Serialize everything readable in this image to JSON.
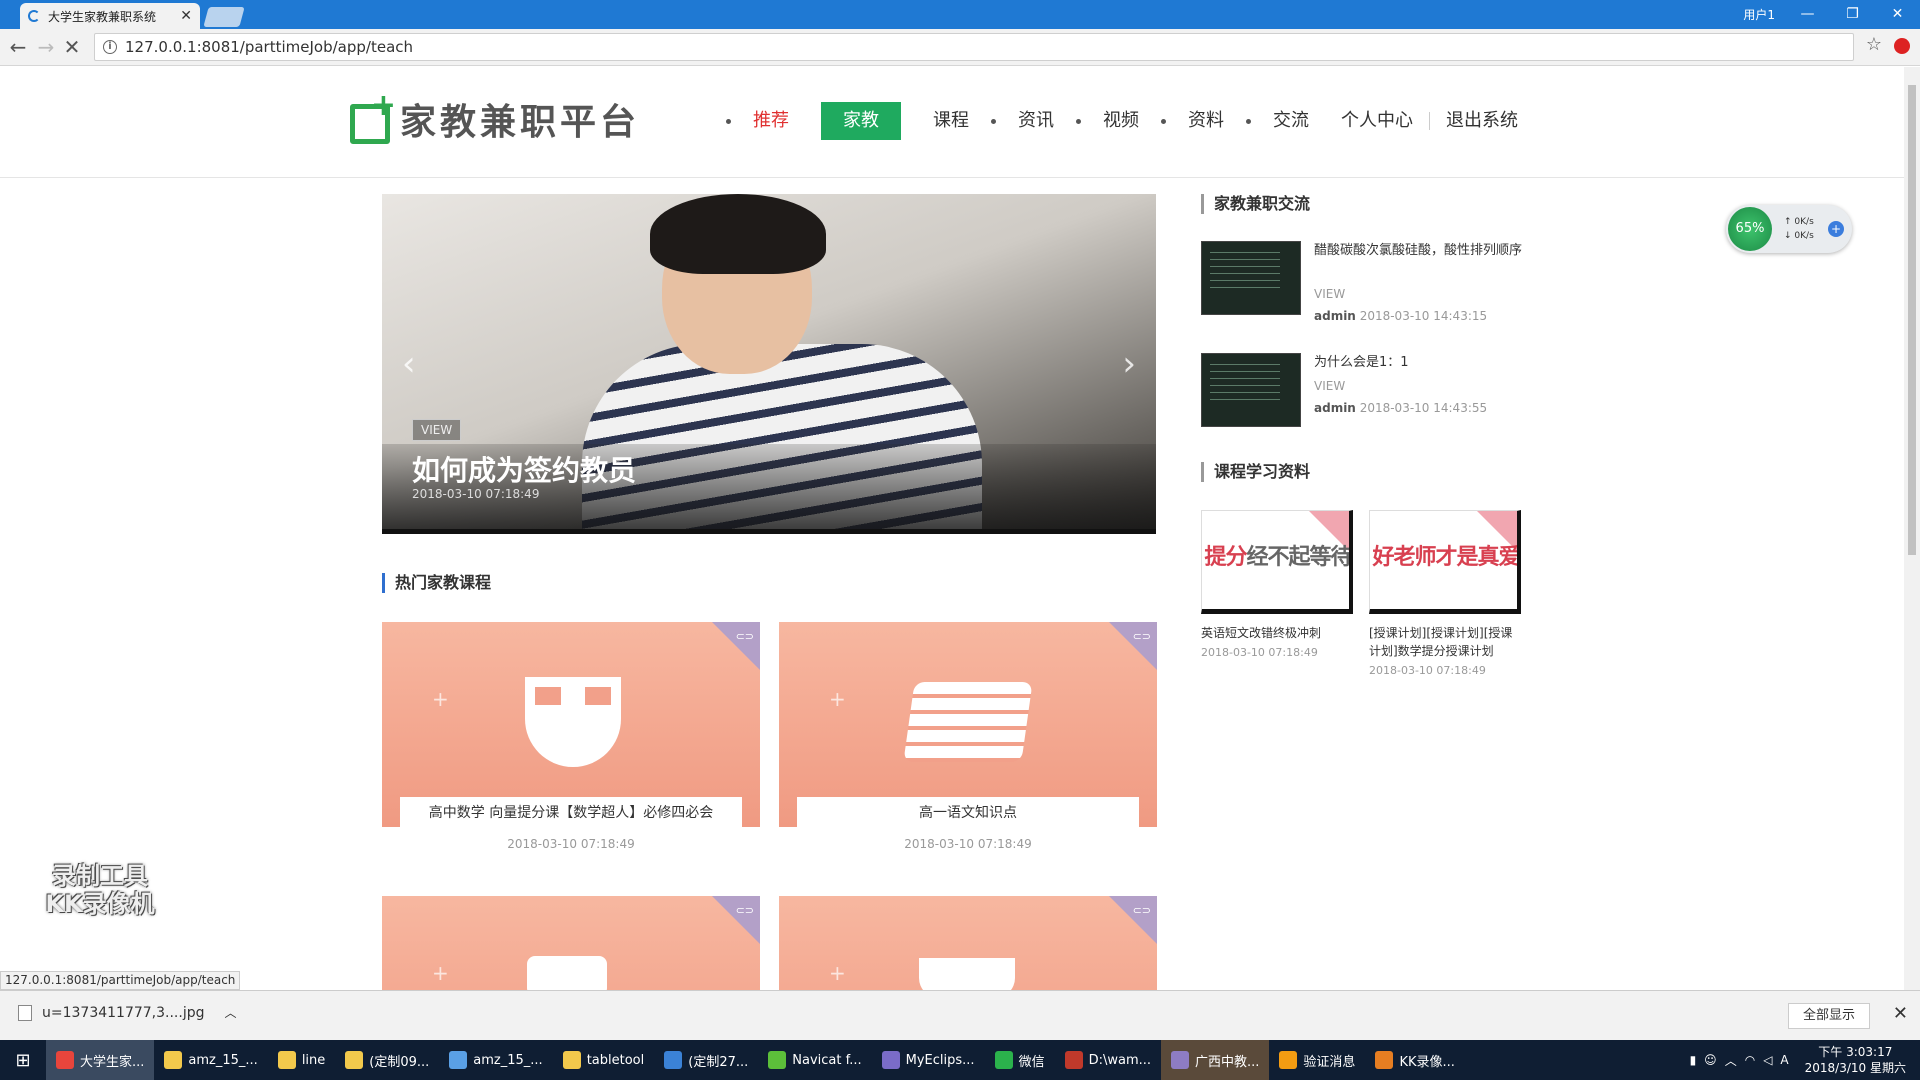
{
  "browser": {
    "tab_title": "大学生家教兼职系统",
    "user_label": "用户1",
    "url": "127.0.0.1:8081/parttimeJob/app/teach",
    "status_url": "127.0.0.1:8081/parttimeJob/app/teach",
    "win_controls": [
      "—",
      "❐",
      "✕"
    ]
  },
  "site": {
    "logo_text": "家教兼职平台",
    "nav": [
      {
        "label": "推荐",
        "style": "red"
      },
      {
        "label": "家教",
        "style": "active"
      },
      {
        "label": "课程"
      },
      {
        "label": "资讯"
      },
      {
        "label": "视频"
      },
      {
        "label": "资料"
      },
      {
        "label": "交流"
      },
      {
        "label": "个人中心"
      },
      {
        "label": "退出系统"
      }
    ]
  },
  "slider": {
    "tag": "VIEW",
    "title": "如何成为签约教员",
    "date": "2018-03-10 07:18:49",
    "prev": "‹",
    "next": "›"
  },
  "hot_courses": {
    "title": "热门家教课程",
    "items": [
      {
        "label": "高中数学 向量提分课【数学超人】必修四必会",
        "date": "2018-03-10 07:18:49"
      },
      {
        "label": "高一语文知识点",
        "date": "2018-03-10 07:18:49"
      },
      {
        "label": "",
        "date": ""
      },
      {
        "label": "",
        "date": ""
      }
    ]
  },
  "exchange": {
    "title": "家教兼职交流",
    "items": [
      {
        "title": "醋酸碳酸次氯酸硅酸，酸性排列顺序",
        "view": "VIEW",
        "author": "admin",
        "time": "2018-03-10 14:43:15"
      },
      {
        "title": "为什么会是1：1",
        "view": "VIEW",
        "author": "admin",
        "time": "2018-03-10 14:43:55"
      }
    ]
  },
  "materials": {
    "title": "课程学习资料",
    "items": [
      {
        "thumb_red": "提分",
        "thumb_gray": "经不起等待",
        "name": "英语短文改错终极冲刺",
        "date": "2018-03-10 07:18:49"
      },
      {
        "thumb_red": "好老师",
        "thumb_gray": "才是真爱",
        "name": "[授课计划][授课计划][授课计划]数学提分授课计划",
        "date": "2018-03-10 07:18:49"
      }
    ]
  },
  "speed_widget": {
    "percent": "65%",
    "up": "0K/s",
    "down": "0K/s"
  },
  "watermark": {
    "line1": "录制工具",
    "line2": "KK录像机"
  },
  "download": {
    "file": "u=1373411777,3....jpg",
    "show_all": "全部显示"
  },
  "taskbar": {
    "items": [
      {
        "label": "大学生家...",
        "color": "#e8453c",
        "state": "active"
      },
      {
        "label": "amz_15_...",
        "color": "#f2c94c"
      },
      {
        "label": "line",
        "color": "#f2c94c"
      },
      {
        "label": "(定制09...",
        "color": "#f2c94c"
      },
      {
        "label": "amz_15_...",
        "color": "#5aa0e6"
      },
      {
        "label": "tabletool",
        "color": "#f2c94c"
      },
      {
        "label": "(定制27...",
        "color": "#3b82d6"
      },
      {
        "label": "Navicat f...",
        "color": "#5cbf3a"
      },
      {
        "label": "MyEclips...",
        "color": "#7a6cc8"
      },
      {
        "label": "微信",
        "color": "#2bb24c"
      },
      {
        "label": "D:\\wam...",
        "color": "#c0392b"
      },
      {
        "label": "广西中教...",
        "color": "#8e7cc3",
        "state": "highlight"
      },
      {
        "label": "验证消息",
        "color": "#f39c12"
      },
      {
        "label": "KK录像...",
        "color": "#e67e22"
      }
    ],
    "clock_time": "下午 3:03:17",
    "clock_date": "2018/3/10 星期六"
  }
}
